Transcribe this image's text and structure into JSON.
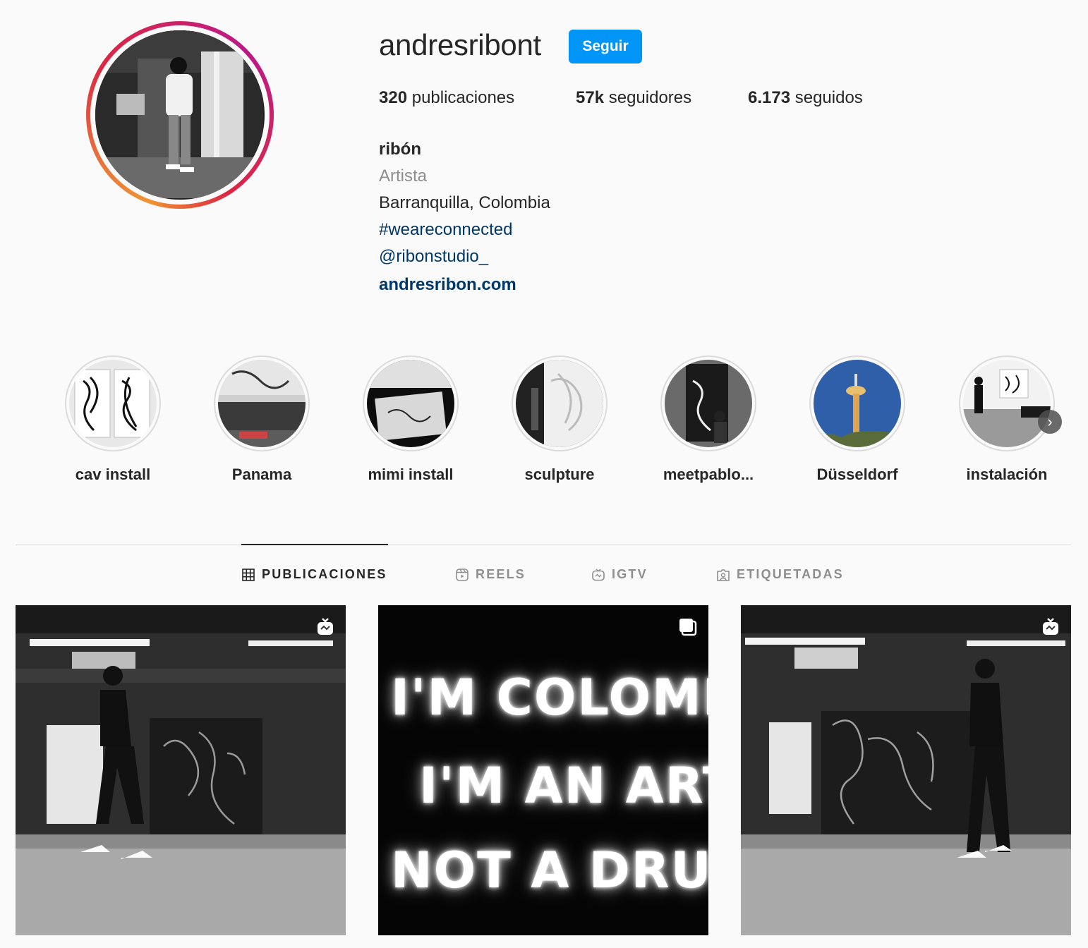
{
  "profile": {
    "username": "andresribont",
    "follow_label": "Seguir",
    "stats": {
      "posts_count": "320",
      "posts_label": " publicaciones",
      "followers_count": "57k",
      "followers_label": " seguidores",
      "following_count": "6.173",
      "following_label": " seguidos"
    },
    "bio": {
      "name": "ribón",
      "category": "Artista",
      "location": "Barranquilla, Colombia",
      "hashtag": "#weareconnected",
      "mention": "@ribonstudio_",
      "link": "andresribon.com"
    }
  },
  "highlights": [
    {
      "label": "cav install"
    },
    {
      "label": "Panama"
    },
    {
      "label": "mimi install"
    },
    {
      "label": "sculpture"
    },
    {
      "label": "meetpablo..."
    },
    {
      "label": "Düsseldorf"
    },
    {
      "label": "instalación"
    }
  ],
  "tabs": [
    {
      "label": "PUBLICACIONES",
      "active": true,
      "icon": "grid-icon"
    },
    {
      "label": "REELS",
      "active": false,
      "icon": "reels-icon"
    },
    {
      "label": "IGTV",
      "active": false,
      "icon": "igtv-icon"
    },
    {
      "label": "ETIQUETADAS",
      "active": false,
      "icon": "tagged-icon"
    }
  ],
  "posts": {
    "neon_lines": [
      "I'M COLOMBIAN",
      "I'M AN ARTIST",
      "NOT A DRUGDEALER"
    ],
    "badges": [
      "igtv-icon",
      "carousel-icon",
      "igtv-icon"
    ]
  },
  "colors": {
    "follow_button": "#0095f6",
    "link": "#00376b",
    "muted": "#8e8e8e"
  }
}
